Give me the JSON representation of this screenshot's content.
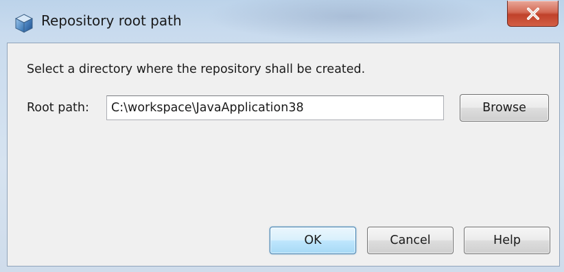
{
  "window": {
    "title": "Repository root path",
    "close_label": "X"
  },
  "dialog": {
    "instruction": "Select a directory where the repository shall be created.",
    "root_path_label": "Root path:",
    "root_path_value": "C:\\workspace\\JavaApplication38",
    "browse_label": "Browse"
  },
  "buttons": {
    "ok_label": "OK",
    "cancel_label": "Cancel",
    "help_label": "Help"
  },
  "icons": {
    "app": "netbeans-cube-icon",
    "close": "close-icon"
  },
  "colors": {
    "close_button": "#c94b33",
    "default_button_border": "#3c7fb1",
    "titlebar": "#c9dbee",
    "client_background": "#f0f0f0"
  }
}
